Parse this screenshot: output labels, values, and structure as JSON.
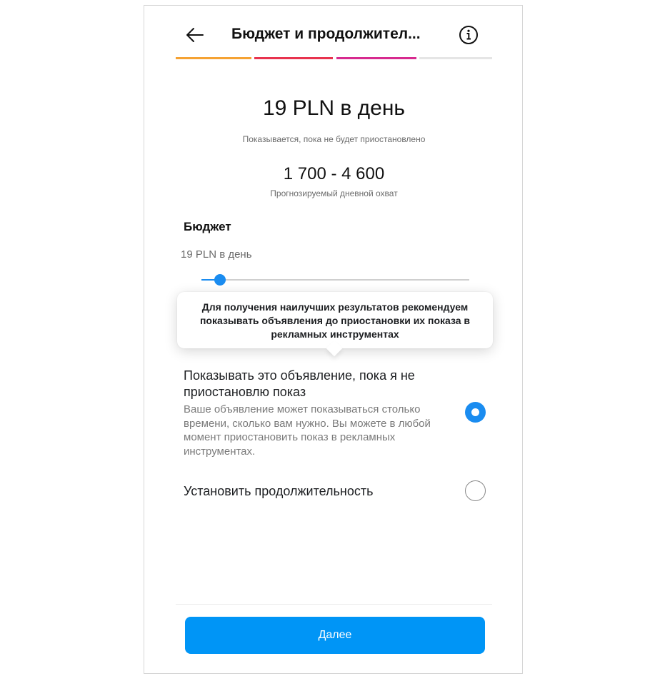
{
  "header": {
    "title": "Бюджет и продолжител...",
    "back_icon": "arrow-left-icon",
    "info_icon": "info-icon"
  },
  "progress_steps": [
    {
      "color": "#F5A233",
      "active": true
    },
    {
      "color": "#E8334E",
      "active": true
    },
    {
      "color": "#D72A8F",
      "active": true
    },
    {
      "color": "#E5E5E5",
      "active": false
    }
  ],
  "summary": {
    "budget": "19 PLN в день",
    "status": "Показывается, пока не будет приостановлено",
    "reach": "1 700 - 4 600",
    "reach_label": "Прогнозируемый дневной охват"
  },
  "budget_section": {
    "title": "Бюджет",
    "value": "19 PLN в день",
    "slider_position": 0.07
  },
  "tooltip": {
    "text": "Для получения наилучших результатов рекомендуем показывать объявления до приостановки их показа в рекламных инструментах"
  },
  "options": [
    {
      "title": "Показывать это объявление, пока я не приостановлю показ",
      "description": "Ваше объявление может показываться столько времени, сколько вам нужно. Вы можете в любой момент приостановить показ в рекламных инструментах.",
      "selected": true
    },
    {
      "title": "Установить продолжительность",
      "selected": false
    }
  ],
  "footer": {
    "next_label": "Далее"
  },
  "colors": {
    "accent": "#0095F6",
    "slider": "#1A8CF0"
  }
}
